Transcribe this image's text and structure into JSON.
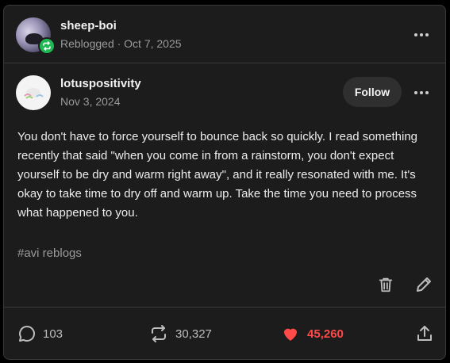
{
  "reblog": {
    "username": "sheep-boi",
    "meta": "Reblogged · Oct 7, 2025"
  },
  "post": {
    "username": "lotuspositivity",
    "date": "Nov 3, 2024",
    "follow_label": "Follow",
    "body": "You don't have to force yourself to bounce back so quickly. I read something recently that said \"when you come in from a rainstorm, you don't expect yourself to be dry and warm right away\", and it really resonated with me. It's okay to take time to dry off and warm up. Take the time you need to process what happened to you.",
    "tags": "#avi reblogs"
  },
  "stats": {
    "comments": "103",
    "reblogs": "30,327",
    "likes": "45,260"
  },
  "colors": {
    "background": "#1c1c1c",
    "reblog_badge": "#1fb854",
    "like": "#ff4a4a"
  },
  "icons": {
    "reblog_badge": "reblog-icon",
    "delete": "trash-icon",
    "edit": "pencil-icon",
    "comments": "speech-bubble-icon",
    "reblogs": "reblog-icon",
    "likes": "heart-icon",
    "share": "share-icon",
    "more": "more-options-icon"
  }
}
